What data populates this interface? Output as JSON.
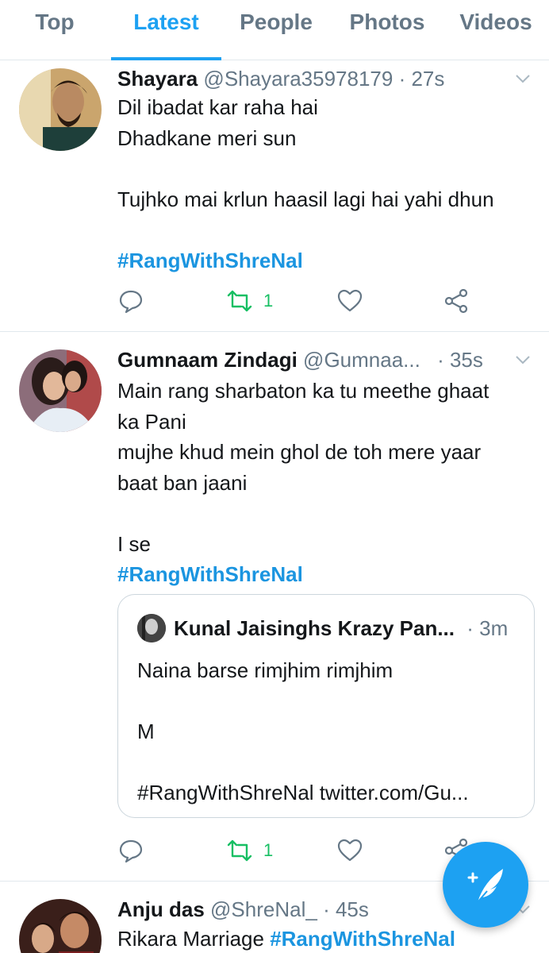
{
  "tabs": [
    {
      "label": "Top"
    },
    {
      "label": "Latest"
    },
    {
      "label": "People"
    },
    {
      "label": "Photos"
    },
    {
      "label": "Videos"
    }
  ],
  "active_tab": "Latest",
  "colors": {
    "accent": "#1da1f2",
    "retweet_green": "#17bf63",
    "meta_gray": "#657786"
  },
  "tweets": [
    {
      "name": "Shayara",
      "handle": "@Shayara35978179",
      "time": "· 27s",
      "lines": [
        "Dil ibadat kar raha hai",
        "Dhadkane meri sun",
        "",
        "Tujhko mai krlun haasil lagi hai yahi dhun",
        ""
      ],
      "hashtag": "#RangWithShreNal",
      "retweet_count": "1"
    },
    {
      "name": "Gumnaam Zindagi",
      "handle": "@Gumnaa...",
      "time": "· 35s",
      "lines": [
        "Main rang sharbaton ka tu meethe ghaat",
        "ka Pani",
        "mujhe khud mein ghol de toh mere yaar",
        "baat ban jaani",
        "",
        "I se"
      ],
      "hashtag": "#RangWithShreNal",
      "retweet_count": "1",
      "quote": {
        "name": "Kunal Jaisinghs Krazy Pan...",
        "time": "· 3m",
        "lines": [
          "Naina barse rimjhim rimjhim",
          "",
          "M",
          "",
          "#RangWithShreNal twitter.com/Gu..."
        ]
      }
    },
    {
      "name": "Anju das",
      "handle": "@ShreNal_",
      "time": "· 45s",
      "text": "Rikara Marriage",
      "hashtag": "#RangWithShreNal"
    }
  ],
  "icons": {
    "reply": "reply-icon",
    "retweet": "retweet-icon",
    "like": "heart-icon",
    "share": "share-icon",
    "compose": "compose-tweet-icon",
    "more": "chevron-down-icon"
  }
}
